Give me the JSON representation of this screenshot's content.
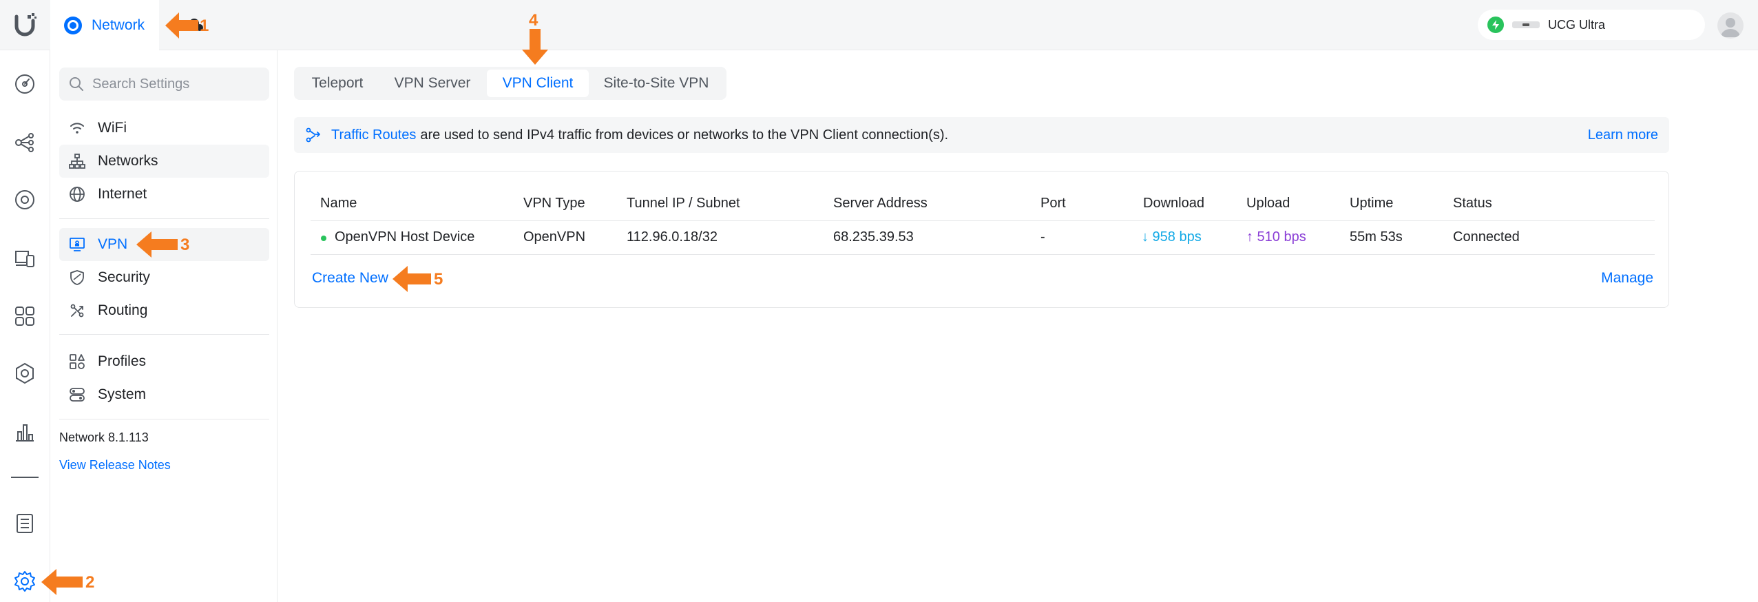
{
  "app": {
    "name": "Network"
  },
  "console": {
    "name": "UCG Ultra"
  },
  "search": {
    "placeholder": "Search Settings"
  },
  "sidebar": {
    "items": [
      {
        "label": "WiFi",
        "icon": "wifi-icon"
      },
      {
        "label": "Networks",
        "icon": "topology-icon"
      },
      {
        "label": "Internet",
        "icon": "globe-icon"
      },
      {
        "label": "VPN",
        "icon": "vpn-icon"
      },
      {
        "label": "Security",
        "icon": "shield-icon"
      },
      {
        "label": "Routing",
        "icon": "routing-icon"
      },
      {
        "label": "Profiles",
        "icon": "profiles-icon"
      },
      {
        "label": "System",
        "icon": "system-icon"
      }
    ],
    "version": "Network 8.1.113",
    "release_notes": "View Release Notes"
  },
  "tabs": [
    "Teleport",
    "VPN Server",
    "VPN Client",
    "Site-to-Site VPN"
  ],
  "active_tab": "VPN Client",
  "banner": {
    "link": "Traffic Routes",
    "text": "are used to send IPv4 traffic from devices or networks to the VPN Client connection(s).",
    "learn_more": "Learn more"
  },
  "table": {
    "headers": [
      "Name",
      "VPN Type",
      "Tunnel IP / Subnet",
      "Server Address",
      "Port",
      "Download",
      "Upload",
      "Uptime",
      "Status"
    ],
    "rows": [
      {
        "name": "OpenVPN Host Device",
        "vpn_type": "OpenVPN",
        "tunnel_ip": "112.96.0.18/32",
        "server_address": "68.235.39.53",
        "port": "-",
        "download": "↓ 958 bps",
        "upload": "↑ 510 bps",
        "uptime": "55m 53s",
        "status": "Connected"
      }
    ],
    "create_new": "Create New",
    "manage": "Manage"
  },
  "annotations": [
    "1",
    "2",
    "3",
    "4",
    "5"
  ],
  "colors": {
    "accent": "#006fff",
    "download": "#13a9e6",
    "upload": "#8a3ed6",
    "online": "#29c35c",
    "annotation": "#f57c1f"
  }
}
